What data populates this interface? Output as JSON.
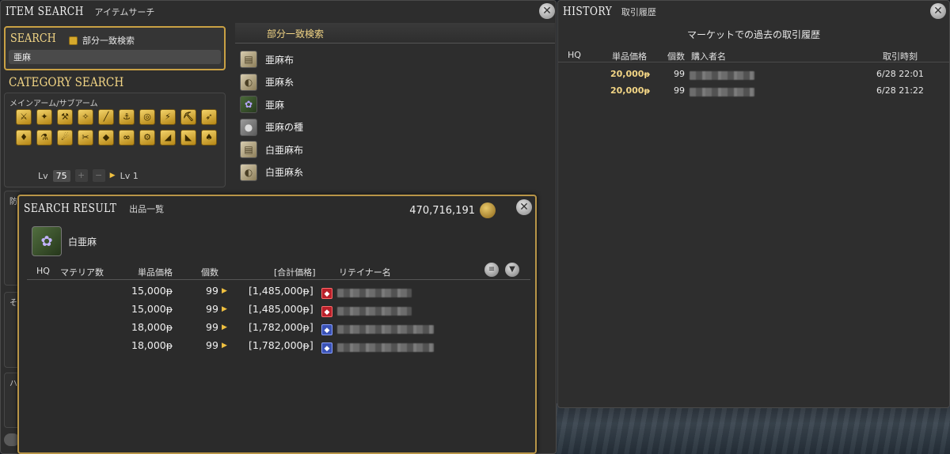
{
  "item_search": {
    "title": "ITEM SEARCH",
    "subtitle": "アイテムサーチ",
    "search_label": "SEARCH",
    "partial_match_label": "部分一致検索",
    "search_value": "亜麻",
    "category_title": "CATEGORY SEARCH",
    "category_sub": "メインアーム/サブアーム",
    "category_icons": [
      "⚔",
      "✦",
      "⚒",
      "✧",
      "╱",
      "⚓",
      "◎",
      "⚡",
      "⛏",
      "➶",
      "♦",
      "⚗",
      "☄",
      "✂",
      "◆",
      "∞",
      "⚙",
      "◢",
      "◣",
      "♠"
    ],
    "lv_label": "Lv",
    "lv_value": "75",
    "lv_plus": "+",
    "lv_minus": "−",
    "lv_target": "Lv 1",
    "side_stubs": [
      "防",
      "そ",
      "ハ"
    ],
    "results_header": "部分一致検索",
    "results": [
      {
        "name": "亜麻布",
        "icon": "cloth-icon"
      },
      {
        "name": "亜麻糸",
        "icon": "yarn-icon"
      },
      {
        "name": "亜麻",
        "icon": "flower-icon"
      },
      {
        "name": "亜麻の種",
        "icon": "seed-icon"
      },
      {
        "name": "白亜麻布",
        "icon": "cloth-icon"
      },
      {
        "name": "白亜麻糸",
        "icon": "yarn-icon"
      }
    ]
  },
  "history": {
    "title": "HISTORY",
    "subtitle": "取引履歴",
    "heading": "マーケットでの過去の取引履歴",
    "columns": {
      "hq": "HQ",
      "price": "単品価格",
      "qty": "個数",
      "buyer": "購入者名",
      "time": "取引時刻"
    },
    "rows": [
      {
        "price": "20,000",
        "qty": "99",
        "time": "6/28 22:01"
      },
      {
        "price": "20,000",
        "qty": "99",
        "time": "6/28 21:22"
      }
    ],
    "currency_symbol": "ᵽ"
  },
  "search_result": {
    "title": "SEARCH RESULT",
    "subtitle": "出品一覧",
    "gil": "470,716,191",
    "item_name": "白亜麻",
    "columns": {
      "hq": "HQ",
      "materia": "マテリア数",
      "price": "単品価格",
      "qty": "個数",
      "total": "[合計価格]",
      "retainer": "リテイナー名"
    },
    "rows": [
      {
        "price": "15,000ᵽ",
        "qty": "99",
        "total": "[1,485,000ᵽ]",
        "retainer_type": "red"
      },
      {
        "price": "15,000ᵽ",
        "qty": "99",
        "total": "[1,485,000ᵽ]",
        "retainer_type": "red"
      },
      {
        "price": "18,000ᵽ",
        "qty": "99",
        "total": "[1,782,000ᵽ]",
        "retainer_type": "blue"
      },
      {
        "price": "18,000ᵽ",
        "qty": "99",
        "total": "[1,782,000ᵽ]",
        "retainer_type": "blue"
      }
    ]
  },
  "colors": {
    "accent_gold": "#f2d585",
    "frame_gold": "#c9a144",
    "retainer_red": "#b8202a",
    "retainer_blue": "#3a52b5"
  }
}
